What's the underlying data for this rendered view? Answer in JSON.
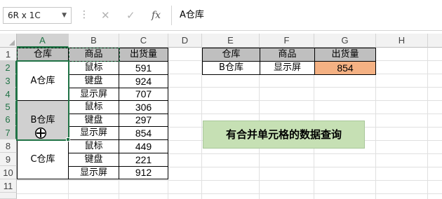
{
  "formula_bar": {
    "name_box": "6R x 1C",
    "separator": "⋮",
    "cancel_icon": "✕",
    "enter_icon": "✓",
    "fx_icon": "fx",
    "content": "A仓库"
  },
  "columns": [
    "A",
    "B",
    "C",
    "D",
    "E",
    "F",
    "G",
    "H"
  ],
  "rows": [
    "1",
    "2",
    "3",
    "4",
    "5",
    "6",
    "7",
    "8",
    "9",
    "10",
    "11"
  ],
  "table": {
    "headers": [
      "仓库",
      "商品",
      "出货量"
    ],
    "warehouses": [
      "A仓库",
      "B仓库",
      "C仓库"
    ],
    "products": [
      "鼠标",
      "键盘",
      "显示屏",
      "鼠标",
      "键盘",
      "显示屏",
      "鼠标",
      "键盘",
      "显示屏"
    ],
    "quantities": [
      "591",
      "924",
      "707",
      "306",
      "297",
      "854",
      "449",
      "221",
      "912"
    ]
  },
  "lookup": {
    "headers": [
      "仓库",
      "商品",
      "出货量"
    ],
    "values": [
      "B仓库",
      "显示屏",
      "854"
    ]
  },
  "banner": "有合并单元格的数据查询",
  "colors": {
    "accent": "#217346",
    "header_fill": "#bfbfbf",
    "result_fill": "#f4b183",
    "banner_fill": "#c6e0b4"
  }
}
